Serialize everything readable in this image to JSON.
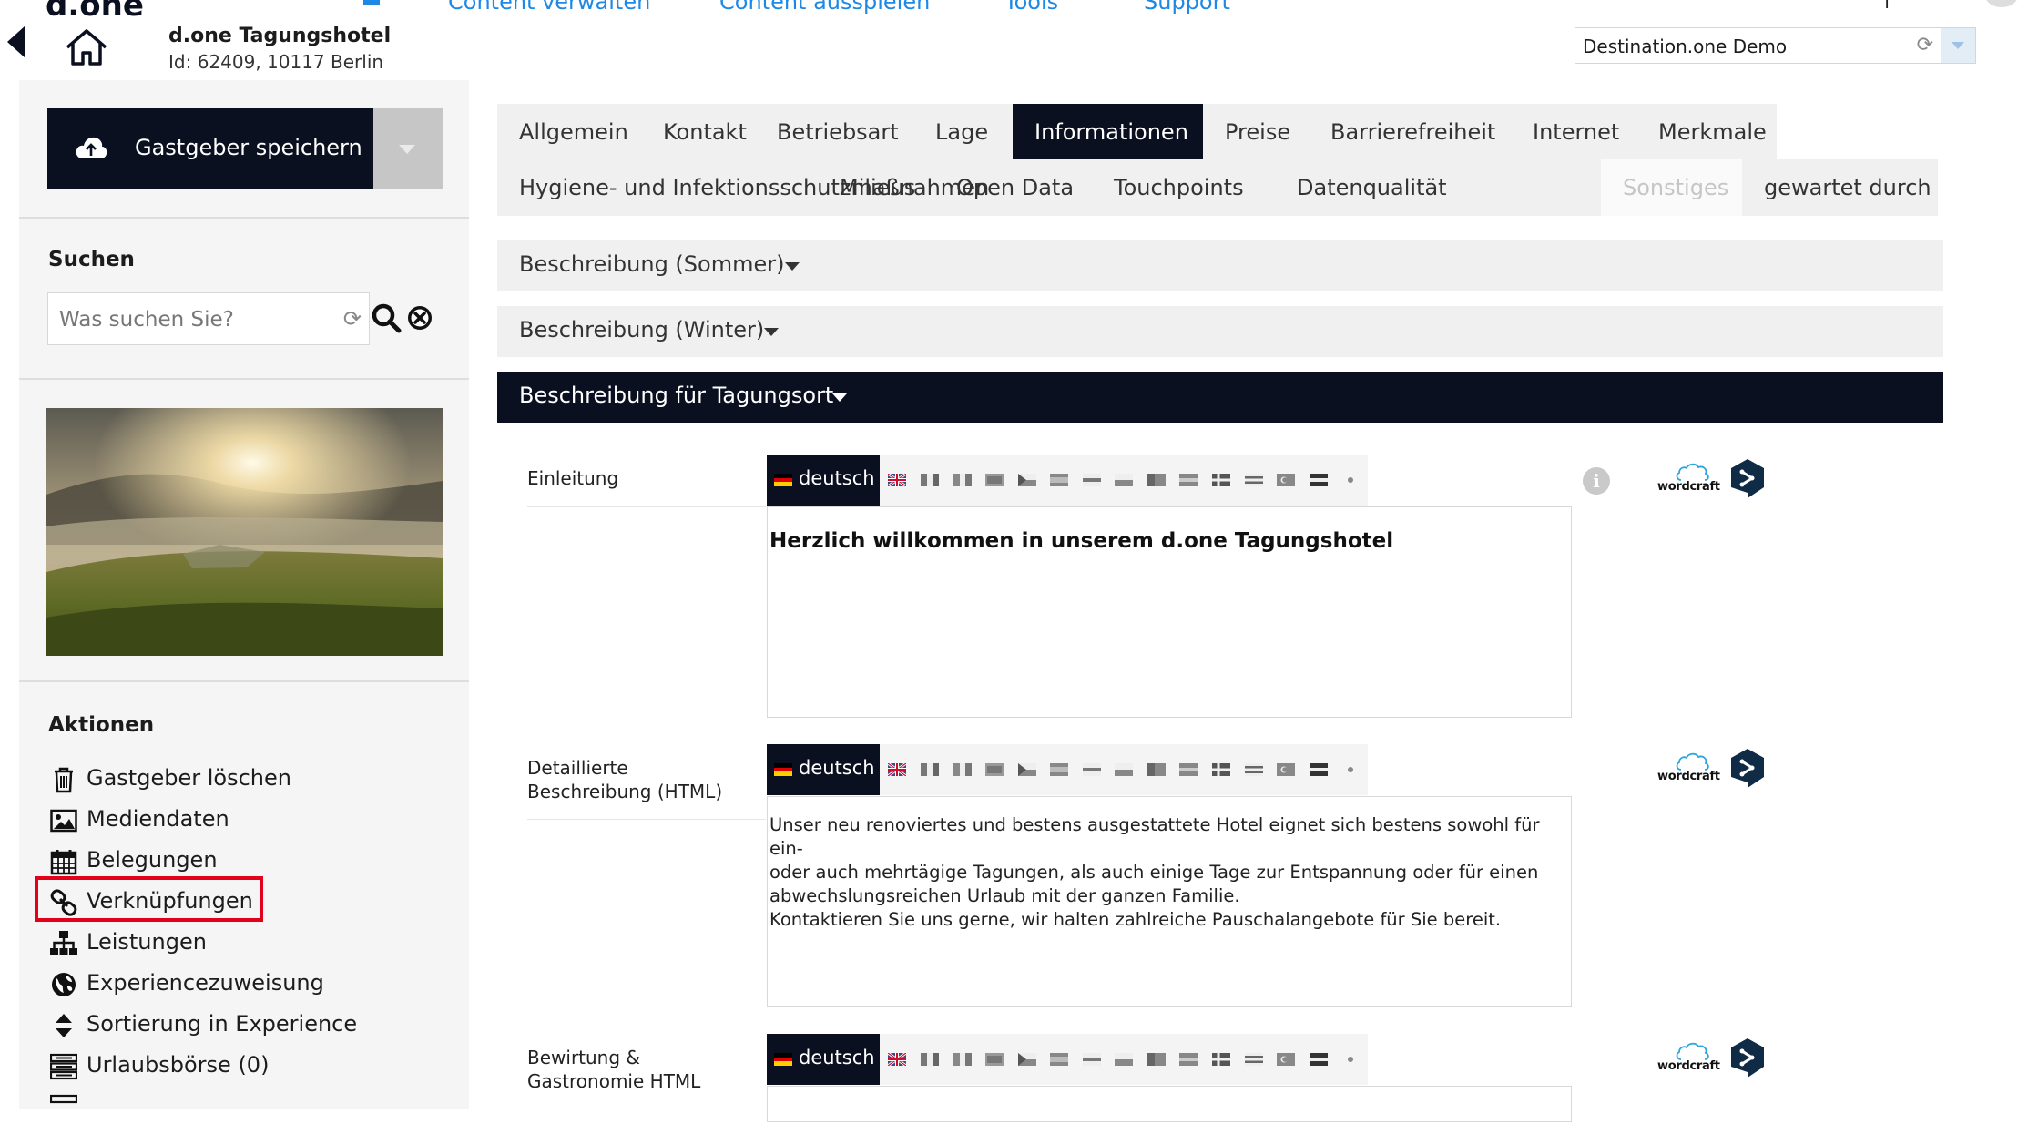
{
  "topnav": {
    "logo": "d.one",
    "links": [
      "Content verwalten",
      "Content ausspielen",
      "Tools",
      "Support"
    ]
  },
  "header": {
    "hotel_name": "d.one Tagungshotel",
    "hotel_id": "Id: 62409, 10117 Berlin",
    "destination_select": "Destination.one Demo"
  },
  "sidebar": {
    "save_label": "Gastgeber speichern",
    "search_title": "Suchen",
    "search_placeholder": "Was suchen Sie?",
    "actions_title": "Aktionen",
    "actions": [
      {
        "label": "Gastgeber löschen",
        "icon": "trash-icon"
      },
      {
        "label": "Mediendaten",
        "icon": "image-icon"
      },
      {
        "label": "Belegungen",
        "icon": "calendar-icon"
      },
      {
        "label": "Verknüpfungen",
        "icon": "link-icon"
      },
      {
        "label": "Leistungen",
        "icon": "sitemap-icon"
      },
      {
        "label": "Experiencezuweisung",
        "icon": "globe-icon"
      },
      {
        "label": "Sortierung in Experience",
        "icon": "sort-icon"
      },
      {
        "label": "Urlaubsbörse (0)",
        "icon": "list-icon"
      }
    ],
    "highlight_color": "#e3001b"
  },
  "tabs": {
    "row1": [
      "Allgemein",
      "Kontakt",
      "Betriebsart",
      "Lage",
      "Informationen",
      "Preise",
      "Barrierefreiheit",
      "Internet",
      "Merkmale"
    ],
    "row2": [
      "Hygiene- und Infektionsschutzmaßnahmen",
      "Milieus",
      "Open Data",
      "Touchpoints",
      "Datenqualität",
      "Sonstiges",
      "gewartet durch"
    ],
    "active": "Informationen",
    "disabled": "Sonstiges"
  },
  "accordions": [
    {
      "label": "Beschreibung (Sommer)",
      "expanded": false
    },
    {
      "label": "Beschreibung (Winter)",
      "expanded": false
    },
    {
      "label": "Beschreibung für Tagungsort",
      "expanded": true
    }
  ],
  "fields": [
    {
      "label": "Einleitung",
      "language": "deutsch",
      "text": "Herzlich willkommen in unserem d.one Tagungshotel"
    },
    {
      "label": "Detaillierte Beschreibung (HTML)",
      "language": "deutsch",
      "text_lines": [
        "Unser neu renoviertes und bestens ausgestattete Hotel eignet sich bestens sowohl für ein-",
        "oder auch mehrtägige Tagungen, als auch einige Tage zur Entspannung oder für einen",
        "abwechslungsreichen Urlaub mit der ganzen Familie.",
        "Kontaktieren Sie uns gerne, wir halten zahlreiche Pauschalangebote für Sie bereit."
      ]
    },
    {
      "label": "Bewirtung & Gastronomie HTML",
      "language": "deutsch",
      "text": ""
    }
  ],
  "tools": {
    "wordcraft": "wordcraft"
  },
  "colors": {
    "dark": "#0b1021",
    "accent_blue": "#1e88e5",
    "highlight": "#e3001b"
  }
}
